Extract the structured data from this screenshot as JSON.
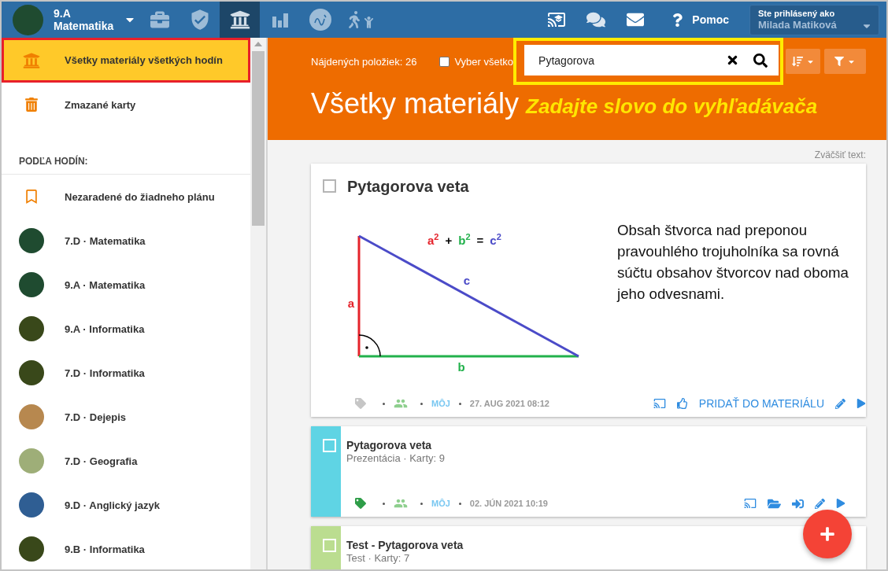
{
  "top_bar": {
    "class_selector": {
      "grade": "9.A",
      "subject": "Matematika"
    },
    "tabs": [
      {
        "kind": "briefcase",
        "selected": false
      },
      {
        "kind": "shield",
        "selected": false
      },
      {
        "kind": "bank",
        "selected": true
      },
      {
        "kind": "chart",
        "selected": false
      },
      {
        "kind": "grade",
        "selected": false
      },
      {
        "kind": "walkers",
        "selected": false
      }
    ],
    "tools": [
      {
        "kind": "cast"
      },
      {
        "kind": "chat"
      },
      {
        "kind": "mail"
      },
      {
        "kind": "help",
        "label": "Pomoc"
      }
    ],
    "user": {
      "caption": "Ste prihlásený ako",
      "name": "Milada Matiková"
    }
  },
  "sidebar": {
    "items": [
      {
        "kind": "all",
        "label": "Všetky materiály všetkých hodín",
        "selected": true,
        "highlighted": true
      },
      {
        "kind": "trash",
        "label": "Zmazané karty",
        "selected": false,
        "highlighted": false
      }
    ],
    "section": {
      "label": "PODĽA HODÍN:",
      "items": [
        {
          "kind": "unassigned",
          "label": "Nezaradené do žiadneho plánu",
          "selected": false
        },
        {
          "kind": "class",
          "label": "7.D · Matematika",
          "color": "#1f4b30",
          "selected": false
        },
        {
          "kind": "class",
          "label": "9.A · Matematika",
          "color": "#1f4b30",
          "selected": false
        },
        {
          "kind": "class",
          "label": "9.A · Informatika",
          "color": "#39481a",
          "selected": false
        },
        {
          "kind": "class",
          "label": "7.D · Informatika",
          "color": "#39481a",
          "selected": false
        },
        {
          "kind": "class",
          "label": "7.D · Dejepis",
          "color": "#b7884f",
          "selected": false
        },
        {
          "kind": "class",
          "label": "7.D · Geografia",
          "color": "#9eae78",
          "selected": false
        },
        {
          "kind": "class",
          "label": "9.D · Anglický jazyk",
          "color": "#2f5e93",
          "selected": false
        },
        {
          "kind": "class",
          "label": "9.B · Informatika",
          "color": "#39481a",
          "selected": false
        }
      ]
    }
  },
  "main": {
    "toolbar": {
      "count": "Nájdených položiek: 26",
      "select_all": {
        "label": "Vyber všetko",
        "checked": false
      },
      "search": {
        "value": "Pytagorova",
        "highlighted": true
      }
    },
    "heading": {
      "title": "Všetky materiály",
      "annotation": "Zadajte slovo do vyhľadávača"
    },
    "zoom_label": "Zväčšiť text:",
    "cards": [
      {
        "kind": "preview",
        "title": "Pytagorova veta",
        "checked": false,
        "figure": {
          "sides": [
            {
              "label": "a",
              "color": "#e5232b"
            },
            {
              "label": "b",
              "color": "#22b14c"
            },
            {
              "label": "c",
              "color": "#4b4bc8"
            }
          ],
          "formula": [
            {
              "kind": "term",
              "text": "a",
              "exponent": "2",
              "color": "#e5232b"
            },
            {
              "kind": "operator",
              "text": "+"
            },
            {
              "kind": "term",
              "text": "b",
              "exponent": "2",
              "color": "#22b14c"
            },
            {
              "kind": "operator",
              "text": "="
            },
            {
              "kind": "term",
              "text": "c",
              "exponent": "2",
              "color": "#4b4bc8"
            }
          ]
        },
        "description": "Obsah štvorca nad preponou pravouhlého trojuholníka sa rovná súčtu obsahov štvorcov nad oboma jeho odvesnami.",
        "meta": {
          "tagged": false,
          "owner": "MÔJ",
          "date": "27. AUG 2021 08:12"
        },
        "actions": [
          {
            "kind": "cast"
          },
          {
            "kind": "like"
          },
          {
            "kind": "link",
            "label": "PRIDAŤ DO MATERIÁLU"
          },
          {
            "kind": "edit"
          },
          {
            "kind": "play"
          }
        ]
      },
      {
        "kind": "compact",
        "color": "#5fd4e4",
        "title": "Pytagorova veta",
        "subtitle": "Prezentácia · Karty: 9",
        "checked": false,
        "meta": {
          "tagged": true,
          "owner": "MÔJ",
          "date": "02. JÚN 2021 10:19"
        },
        "actions": [
          {
            "kind": "cast"
          },
          {
            "kind": "folder"
          },
          {
            "kind": "import"
          },
          {
            "kind": "edit"
          },
          {
            "kind": "play"
          }
        ]
      },
      {
        "kind": "compact",
        "color": "#bbdd90",
        "title": "Test - Pytagorova veta",
        "subtitle": "Test · Karty: 7",
        "checked": false
      }
    ]
  }
}
